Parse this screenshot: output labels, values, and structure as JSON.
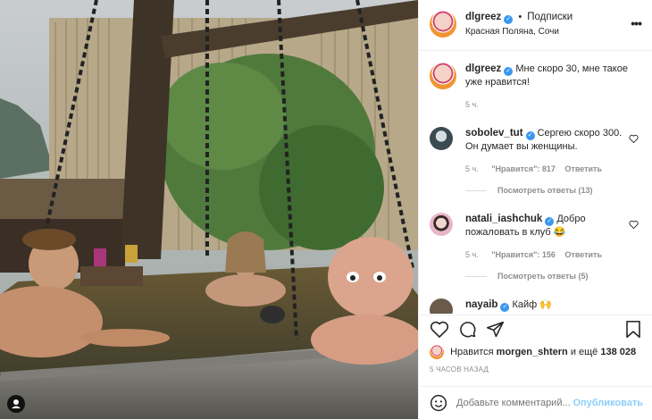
{
  "post": {
    "author": "dlgreez",
    "follow_label": "Подписки",
    "location": "Красная Поляна, Сочи",
    "more_icon": "more-dots-icon"
  },
  "caption": {
    "author": "dlgreez",
    "text": "Мне скоро 30, мне такое уже нравится!",
    "time": "5 ч."
  },
  "comments": [
    {
      "author": "sobolev_tut",
      "text": "Сергею скоро 300. Он думает вы женщины.",
      "time": "5 ч.",
      "likes": "\"Нравится\": 817",
      "reply": "Ответить",
      "view_replies": "Посмотреть ответы (13)"
    },
    {
      "author": "natali_iashchuk",
      "text": "Добро пожаловать в клуб 😂",
      "time": "5 ч.",
      "likes": "\"Нравится\": 156",
      "reply": "Ответить",
      "view_replies": "Посмотреть ответы (5)"
    },
    {
      "author": "nayaib",
      "text": "Кайф 🙌"
    }
  ],
  "likes": {
    "prefix": "Нравится",
    "user": "morgen_shtern",
    "connector": "и ещё",
    "count": "138 028"
  },
  "posted_ago": "5 ЧАСОВ НАЗАД",
  "add_comment": {
    "placeholder": "Добавьте комментарий...",
    "publish": "Опубликовать"
  },
  "colors": {
    "accent": "#0095f6",
    "verified": "#3897f0",
    "secondary_text": "#8e8e8e"
  }
}
